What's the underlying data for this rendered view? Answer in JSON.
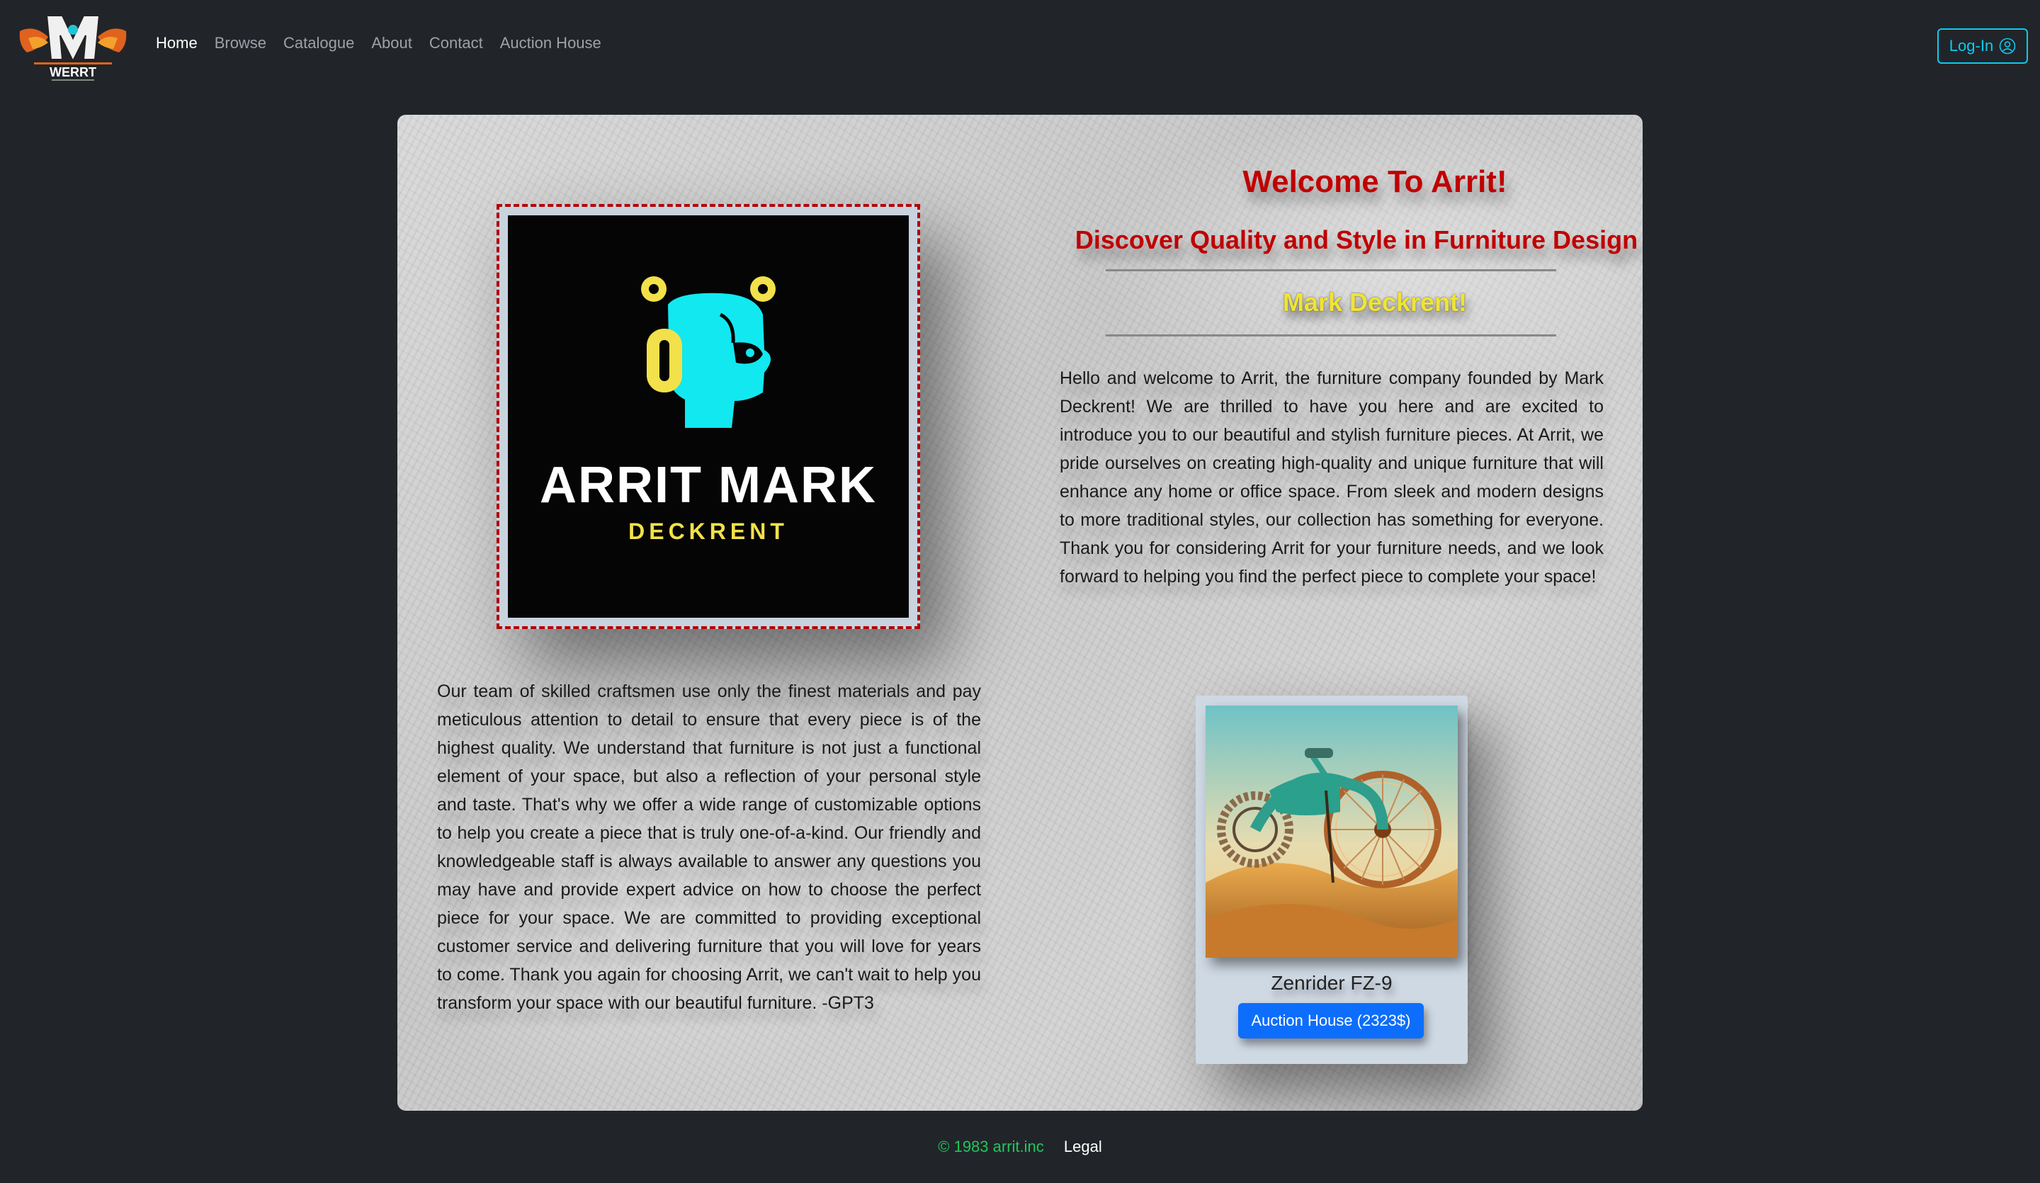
{
  "nav": {
    "brand_logo_text": "WERRT",
    "links": [
      "Home",
      "Browse",
      "Catalogue",
      "About",
      "Contact",
      "Auction House"
    ],
    "active": "Home",
    "login_label": "Log-In"
  },
  "hero": {
    "brand_image": {
      "title": "ARRIT MARK",
      "subtitle": "DECKRENT"
    },
    "welcome_title": "Welcome To Arrit!",
    "welcome_subtitle": "Discover Quality and Style in Furniture Design by",
    "owner_name": "Mark Deckrent!",
    "intro_text": "Hello and welcome to Arrit, the furniture company founded by Mark Deckrent! We are thrilled to have you here and are excited to introduce you to our beautiful and stylish furniture pieces. At Arrit, we pride ourselves on creating high-quality and unique furniture that will enhance any home or office space. From sleek and modern designs to more traditional styles, our collection has something for everyone. Thank you for considering Arrit for your furniture needs, and we look forward to helping you find the perfect piece to complete your space!",
    "team_text": "Our team of skilled craftsmen use only the finest materials and pay meticulous attention to detail to ensure that every piece is of the highest quality. We understand that furniture is not just a functional element of your space, but also a reflection of your personal style and taste. That's why we offer a wide range of customizable options to help you create a piece that is truly one-of-a-kind. Our friendly and knowledgeable staff is always available to answer any questions you may have and provide expert advice on how to choose the perfect piece for your space. We are committed to providing exceptional customer service and delivering furniture that you will love for years to come. Thank you again for choosing Arrit, we can't wait to help you transform your space with our beautiful furniture. -GPT3"
  },
  "product": {
    "name": "Zenrider FZ-9",
    "button_label": "Auction House (2323$)"
  },
  "footer": {
    "copyright": "© 1983 arrit.inc",
    "legal": "Legal"
  },
  "colors": {
    "page_bg": "#212529",
    "accent_red": "#c00000",
    "accent_yellow": "#f0e433",
    "login_cyan": "#0dcaf0",
    "button_blue": "#0d6efd",
    "footer_green": "#22c55e"
  }
}
